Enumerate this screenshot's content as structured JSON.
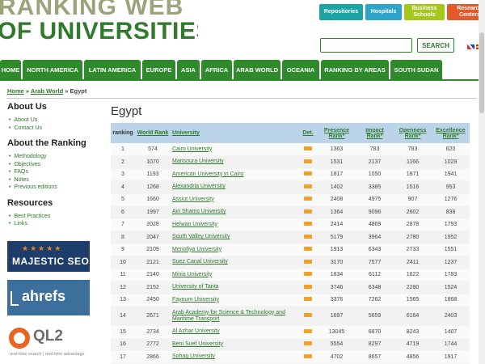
{
  "logo": {
    "line1": "RANKING WEB",
    "line2": "OF UNIVERSITIES"
  },
  "top_buttons": [
    {
      "label": "Repositories"
    },
    {
      "label": "Hospitals"
    },
    {
      "label": "Business Schools"
    },
    {
      "label": "Research Centers"
    }
  ],
  "search": {
    "button_label": "SEARCH",
    "value": ""
  },
  "nav": [
    "HOME",
    "NORTH AMERICA",
    "LATIN AMERICA",
    "EUROPE",
    "ASIA",
    "AFRICA",
    "ARAB WORLD",
    "OCEANIA",
    "RANKING BY AREAS",
    "SOUTH SUDAN"
  ],
  "breadcrumb": {
    "home": "Home",
    "sep1": " » ",
    "arab": "Arab World",
    "sep2": " » ",
    "current": "Egypt"
  },
  "sidebar": {
    "about_us": {
      "title": "About Us",
      "items": [
        "About Us",
        "Contact Us"
      ]
    },
    "about_ranking": {
      "title": "About the Ranking",
      "items": [
        "Methodology",
        "Objectives",
        "FAQs",
        "Notes",
        "Previous editions"
      ]
    },
    "resources": {
      "title": "Resources",
      "items": [
        "Best Practices",
        "Links"
      ]
    }
  },
  "ads": {
    "majestic": {
      "stars": "★★★★★",
      "text": "MAJESTIC SEO"
    },
    "ahrefs": {
      "text": "ahrefs"
    },
    "ql2": {
      "text": "QL2",
      "tagline": "real-time search | real-time advantage"
    }
  },
  "page_title": "Egypt",
  "table": {
    "headers": {
      "ranking": "ranking",
      "world_rank": "World Rank",
      "university": "University",
      "det": "Det.",
      "presence": "Presence Rank*",
      "impact": "Impact Rank*",
      "openness": "Openness Rank*",
      "excellence": "Excellence Rank*"
    },
    "rows": [
      {
        "rank": "1",
        "world": "574",
        "name": "Cairo University",
        "presence": "1363",
        "impact": "783",
        "openness": "783",
        "excellence": "620"
      },
      {
        "rank": "2",
        "world": "1070",
        "name": "Mansoura University",
        "presence": "1531",
        "impact": "2137",
        "openness": "1166",
        "excellence": "1029"
      },
      {
        "rank": "3",
        "world": "1193",
        "name": "American University in Cairo",
        "presence": "1817",
        "impact": "1050",
        "openness": "1871",
        "excellence": "1941"
      },
      {
        "rank": "4",
        "world": "1268",
        "name": "Alexandria University",
        "presence": "1402",
        "impact": "3385",
        "openness": "1516",
        "excellence": "953"
      },
      {
        "rank": "5",
        "world": "1660",
        "name": "Assiut University",
        "presence": "2408",
        "impact": "4975",
        "openness": "907",
        "excellence": "1276"
      },
      {
        "rank": "6",
        "world": "1997",
        "name": "Ain Shams University",
        "presence": "1364",
        "impact": "9096",
        "openness": "2602",
        "excellence": "838"
      },
      {
        "rank": "7",
        "world": "2028",
        "name": "Helwan University",
        "presence": "2414",
        "impact": "4869",
        "openness": "2878",
        "excellence": "1793"
      },
      {
        "rank": "8",
        "world": "2047",
        "name": "South Valley University",
        "presence": "5179",
        "impact": "3964",
        "openness": "2780",
        "excellence": "1952"
      },
      {
        "rank": "9",
        "world": "2109",
        "name": "Menofiya University",
        "presence": "1913",
        "impact": "6343",
        "openness": "2733",
        "excellence": "1551"
      },
      {
        "rank": "10",
        "world": "2121",
        "name": "Suez Canal University",
        "presence": "3170",
        "impact": "7577",
        "openness": "2411",
        "excellence": "1237"
      },
      {
        "rank": "11",
        "world": "2140",
        "name": "Minia University",
        "presence": "1834",
        "impact": "6112",
        "openness": "1622",
        "excellence": "1783"
      },
      {
        "rank": "12",
        "world": "2152",
        "name": "University of Tanta",
        "presence": "3746",
        "impact": "6348",
        "openness": "2280",
        "excellence": "1524"
      },
      {
        "rank": "13",
        "world": "2450",
        "name": "Fayoum University",
        "presence": "3376",
        "impact": "7262",
        "openness": "1565",
        "excellence": "1868"
      },
      {
        "rank": "14",
        "world": "2671",
        "name": "Arab Academy for Science & Technology and Maritime Transport",
        "presence": "1697",
        "impact": "5659",
        "openness": "6164",
        "excellence": "2403"
      },
      {
        "rank": "15",
        "world": "2734",
        "name": "Al Azhar University",
        "presence": "13045",
        "impact": "6870",
        "openness": "8243",
        "excellence": "1407"
      },
      {
        "rank": "16",
        "world": "2772",
        "name": "Beni Suef University",
        "presence": "5554",
        "impact": "8297",
        "openness": "4719",
        "excellence": "1744"
      },
      {
        "rank": "17",
        "world": "2866",
        "name": "Sohag University",
        "presence": "4702",
        "impact": "8657",
        "openness": "4856",
        "excellence": "1917"
      }
    ]
  }
}
